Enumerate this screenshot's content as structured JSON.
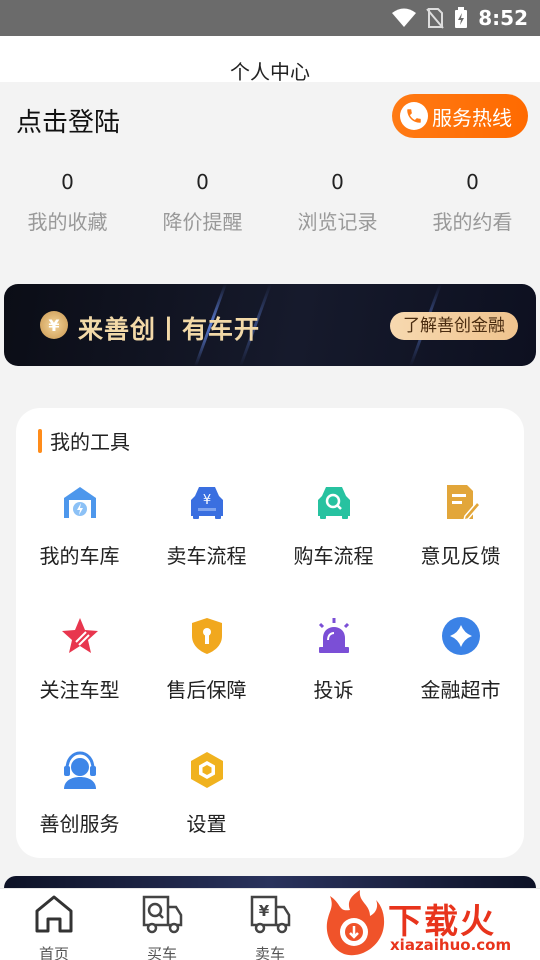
{
  "status_bar": {
    "time": "8:52"
  },
  "header": {
    "title": "个人中心"
  },
  "profile": {
    "login_label": "点击登陆",
    "hotline_label": "服务热线",
    "stats": [
      {
        "value": "0",
        "label": "我的收藏"
      },
      {
        "value": "0",
        "label": "降价提醒"
      },
      {
        "value": "0",
        "label": "浏览记录"
      },
      {
        "value": "0",
        "label": "我的约看"
      }
    ]
  },
  "banner": {
    "coin_symbol": "¥",
    "slogan": "来善创丨有车开",
    "button_label": "了解善创金融"
  },
  "tools": {
    "title": "我的工具",
    "items": [
      {
        "label": "我的车库",
        "icon": "garage-icon",
        "color": "#3d8ee8"
      },
      {
        "label": "卖车流程",
        "icon": "sell-car-icon",
        "color": "#3a6fe0"
      },
      {
        "label": "购车流程",
        "icon": "buy-car-icon",
        "color": "#27c2a0"
      },
      {
        "label": "意见反馈",
        "icon": "feedback-icon",
        "color": "#e2a63a"
      },
      {
        "label": "关注车型",
        "icon": "star-icon",
        "color": "#e8364e"
      },
      {
        "label": "售后保障",
        "icon": "shield-icon",
        "color": "#f1a81e"
      },
      {
        "label": "投诉",
        "icon": "alarm-icon",
        "color": "#7b4fd6"
      },
      {
        "label": "金融超市",
        "icon": "diamond-icon",
        "color": "#3b82e6"
      },
      {
        "label": "善创服务",
        "icon": "customer-service-icon",
        "color": "#3e86e8"
      },
      {
        "label": "设置",
        "icon": "hexagon-settings-icon",
        "color": "#f0b21e"
      }
    ]
  },
  "tabbar": {
    "items": [
      {
        "label": "首页",
        "icon": "home-icon"
      },
      {
        "label": "买车",
        "icon": "buy-truck-icon"
      },
      {
        "label": "卖车",
        "icon": "sell-truck-icon"
      }
    ]
  },
  "watermark": {
    "text": "下载火",
    "url": "xiazaihuo.com"
  }
}
